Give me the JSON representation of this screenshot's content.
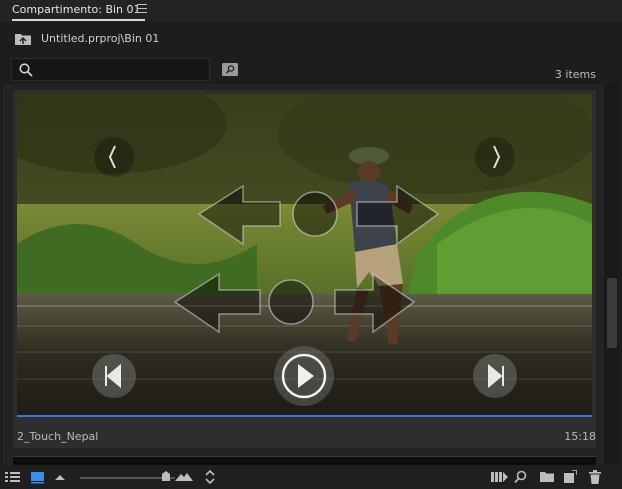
{
  "panel": {
    "tab_title": "Compartimento: Bin 01",
    "path": "Untitled.prproj\\Bin 01",
    "item_count": "3 items"
  },
  "search": {
    "placeholder": "",
    "value": ""
  },
  "clip": {
    "name": "2_Touch_Nepal",
    "duration": "15:18",
    "playhead_fraction": 0.69
  },
  "colors": {
    "accent": "#4b6fd8",
    "panel_bg": "#1d1d1d"
  },
  "icons": {
    "list_view": "list-view-icon",
    "icon_view": "icon-view-icon",
    "freeform_view": "freeform-view-icon",
    "zoom_out": "small-mountain-icon",
    "zoom_in": "large-mountain-icon",
    "sort": "sort-icon",
    "automate": "automate-to-sequence-icon",
    "find": "find-icon",
    "new_bin": "new-bin-icon",
    "new_item": "new-item-icon",
    "clear": "trash-icon"
  }
}
